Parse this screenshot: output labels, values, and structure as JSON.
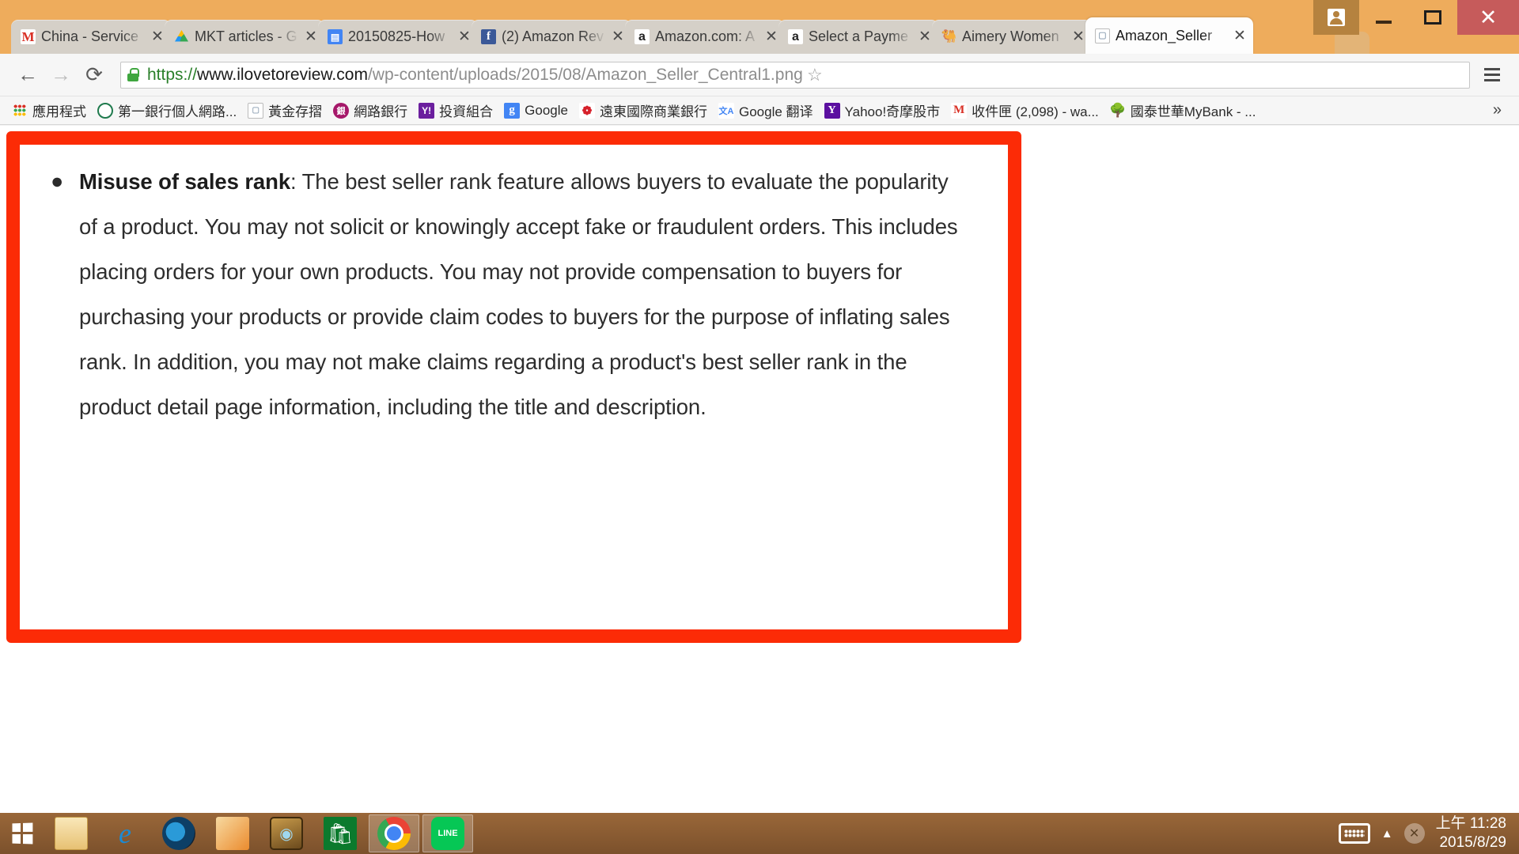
{
  "window": {
    "controls": {
      "avatar_label": "user-avatar",
      "minimize_label": "–",
      "maximize_label": "",
      "close_label": "✕"
    }
  },
  "tabs": [
    {
      "title": "China - Service",
      "favicon": "gmail-icon",
      "favicon_glyph": "M",
      "active": false,
      "close_label": "✕"
    },
    {
      "title": "MKT articles - G",
      "favicon": "google-drive-icon",
      "favicon_glyph": "",
      "active": false,
      "close_label": "✕"
    },
    {
      "title": "20150825-How",
      "favicon": "google-docs-icon",
      "favicon_glyph": "▤",
      "active": false,
      "close_label": "✕"
    },
    {
      "title": "(2) Amazon Rev",
      "favicon": "facebook-icon",
      "favicon_glyph": "f",
      "active": false,
      "close_label": "✕"
    },
    {
      "title": "Amazon.com: A",
      "favicon": "amazon-icon",
      "favicon_glyph": "a",
      "active": false,
      "close_label": "✕"
    },
    {
      "title": "Select a Payme",
      "favicon": "amazon-icon",
      "favicon_glyph": "a",
      "active": false,
      "close_label": "✕"
    },
    {
      "title": "Aimery Women",
      "favicon": "camel-icon",
      "favicon_glyph": "🐫",
      "active": false,
      "close_label": "✕"
    },
    {
      "title": "Amazon_Seller",
      "favicon": "page-icon",
      "favicon_glyph": "▢",
      "active": true,
      "close_label": "✕"
    }
  ],
  "toolbar": {
    "back_label": "←",
    "forward_label": "→",
    "reload_label": "⟳",
    "star_label": "☆",
    "menu_label": "menu",
    "security_icon": "lock-icon",
    "url": {
      "scheme": "https://",
      "host": "www.ilovetoreview.com",
      "path": "/wp-content/uploads/2015/08/Amazon_Seller_Central1.png",
      "full": "https://www.ilovetoreview.com/wp-content/uploads/2015/08/Amazon_Seller_Central1.png"
    }
  },
  "bookmarks": {
    "items": [
      {
        "label": "應用程式",
        "icon": "apps-grid-icon",
        "glyph": ""
      },
      {
        "label": "第一銀行個人網路...",
        "icon": "first-bank-icon",
        "glyph": ""
      },
      {
        "label": "黃金存摺",
        "icon": "document-icon",
        "glyph": "▢"
      },
      {
        "label": "網路銀行",
        "icon": "bank-icon",
        "glyph": "銀"
      },
      {
        "label": "投資組合",
        "icon": "yahoo-icon",
        "glyph": "Y!"
      },
      {
        "label": "Google",
        "icon": "google-icon",
        "glyph": "g"
      },
      {
        "label": "遠東國際商業銀行",
        "icon": "far-eastern-bank-icon",
        "glyph": "❁"
      },
      {
        "label": "Google 翻译",
        "icon": "google-translate-icon",
        "glyph": "文A"
      },
      {
        "label": "Yahoo!奇摩股市",
        "icon": "yahoo-stock-icon",
        "glyph": "Y"
      },
      {
        "label": "收件匣 (2,098) - wa...",
        "icon": "gmail-icon",
        "glyph": "M"
      },
      {
        "label": "國泰世華MyBank - ...",
        "icon": "cathay-tree-icon",
        "glyph": "🌳"
      }
    ],
    "overflow_label": "»"
  },
  "content": {
    "bullet_marker": "●",
    "heading": "Misuse of sales rank",
    "body": ": The best seller rank feature allows buyers to evaluate the popularity of a product. You may not solicit or knowingly accept fake or fraudulent orders. This includes placing orders for your own products. You may not provide compensation to buyers for purchasing your products or provide claim codes to buyers for the purpose of inflating sales rank. In addition, you may not make claims regarding a product's best seller rank in the product detail page information, including the title and description.",
    "highlight_color": "#fc2b06",
    "text_color": "#2d2d2d"
  },
  "taskbar": {
    "start_label": "start",
    "items": [
      {
        "name": "file-explorer-icon",
        "glyph": ""
      },
      {
        "name": "internet-explorer-icon",
        "glyph": "e"
      },
      {
        "name": "cyberlink-icon",
        "glyph": ""
      },
      {
        "name": "photo-viewer-icon",
        "glyph": ""
      },
      {
        "name": "hearthstone-icon",
        "glyph": "◉"
      },
      {
        "name": "windows-store-icon",
        "glyph": "🛍"
      },
      {
        "name": "chrome-icon",
        "glyph": ""
      },
      {
        "name": "line-icon",
        "glyph": "LINE"
      }
    ],
    "tray": {
      "keyboard_label": "keyboard-icon",
      "show_hidden_label": "▲",
      "close_label": "✕",
      "time": "上午 11:28",
      "date": "2015/8/29"
    }
  }
}
